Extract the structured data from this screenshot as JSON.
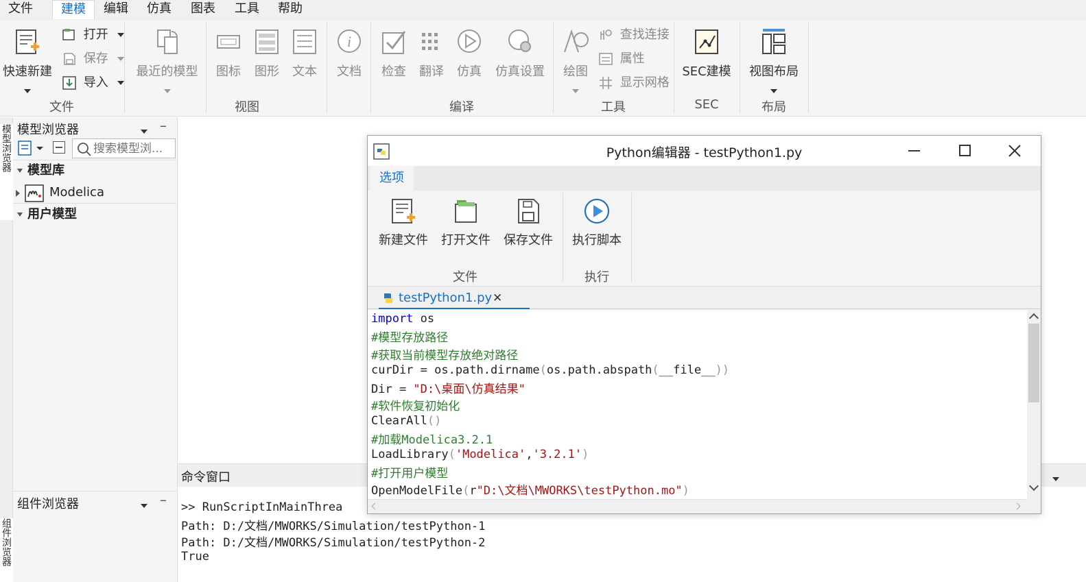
{
  "menubar": {
    "items": [
      "文件",
      "建模",
      "编辑",
      "仿真",
      "图表",
      "工具",
      "帮助"
    ],
    "active": "建模"
  },
  "ribbon": {
    "file": {
      "quick_new": "快速新建",
      "open": "打开",
      "save": "保存",
      "import": "导入",
      "group": "文件"
    },
    "view": {
      "recent": "最近的模型",
      "icon": "图标",
      "diagram": "图形",
      "text": "文本",
      "doc": "文档",
      "group": "视图"
    },
    "compile": {
      "check": "检查",
      "translate": "翻译",
      "simulate": "仿真",
      "sim_settings": "仿真设置",
      "group": "编译"
    },
    "tools": {
      "draw": "绘图",
      "find_connection": "查找连接",
      "properties": "属性",
      "show_grid": "显示网格",
      "group": "工具"
    },
    "sec": {
      "sec_model": "SEC建模",
      "group": "SEC"
    },
    "layout": {
      "view_layout": "视图布局",
      "group": "布局"
    }
  },
  "side_tabs": {
    "model_browser": "模型浏览器",
    "component_browser": "组件浏览器"
  },
  "model_browser": {
    "title": "模型浏览器",
    "search_placeholder": "搜索模型浏...",
    "sections": {
      "library": "模型库",
      "user": "用户模型"
    },
    "library_items": [
      "Modelica"
    ]
  },
  "component_browser": {
    "title": "组件浏览器"
  },
  "command_window": {
    "title": "命令窗口",
    "lines": [
      ">> RunScriptInMainThrea",
      "Path: D:/文档/MWORKS/Simulation/testPython-1",
      "Path: D:/文档/MWORKS/Simulation/testPython-2",
      "True"
    ]
  },
  "python_editor": {
    "title": "Python编辑器 - testPython1.py",
    "tab": "选项",
    "buttons": {
      "new_file": "新建文件",
      "open_file": "打开文件",
      "save_file": "保存文件",
      "run_script": "执行脚本"
    },
    "groups": {
      "file": "文件",
      "run": "执行"
    },
    "file_tab": "testPython1.py",
    "code": {
      "l1_kw": "import",
      "l1_rest": " os",
      "l2": "#模型存放路径",
      "l3": "#获取当前模型存放绝对路径",
      "l4_a": "curDir = os.path.dirname",
      "l4_b": "(",
      "l4_c": "os.path.abspath",
      "l4_d": "(",
      "l4_e": "__file__",
      "l4_f": "))",
      "l5_a": "Dir = ",
      "l5_b": "\"D:\\桌面\\仿真结果\"",
      "l6": "#软件恢复初始化",
      "l7_a": "ClearAll",
      "l7_b": "()",
      "l8": "#加载Modelica3.2.1",
      "l9_a": "LoadLibrary",
      "l9_b": "(",
      "l9_c": "'Modelica'",
      "l9_d": ",",
      "l9_e": "'3.2.1'",
      "l9_f": ")",
      "l10": "#打开用户模型",
      "l11_a": "OpenModelFile",
      "l11_b": "(",
      "l11_c": "r",
      "l11_d": "\"D:\\文档\\MWORKS\\testPython.mo\"",
      "l11_e": ")"
    }
  },
  "colors": {
    "accent": "#1a6fc9",
    "comment": "#2f7d2f",
    "string": "#a31515",
    "keyword": "#0000ff"
  }
}
